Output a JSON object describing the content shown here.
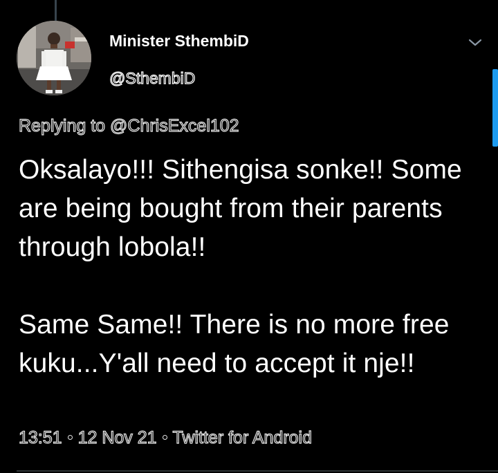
{
  "tweet": {
    "author": {
      "display_name": "Minister SthembiD",
      "handle": "@SthembiD",
      "avatar_icon": "profile-photo"
    },
    "reply_context": "Replying to @ChrisExcel102",
    "body": {
      "paragraph_1": "Oksalayo!!! Sithengisa sonke!! Some are being bought from their parents through lobola!!",
      "paragraph_2": "Same Same!! There is no more free kuku...Y'all need to accept it nje!!"
    },
    "meta": {
      "time": "13:51",
      "date": "12 Nov 21",
      "source": "Twitter for Android"
    },
    "menu_icon": "chevron-down-icon"
  },
  "colors": {
    "background": "#000000",
    "text": "#ffffff",
    "accent": "#1d9bf0",
    "thread_line": "#38444d"
  }
}
